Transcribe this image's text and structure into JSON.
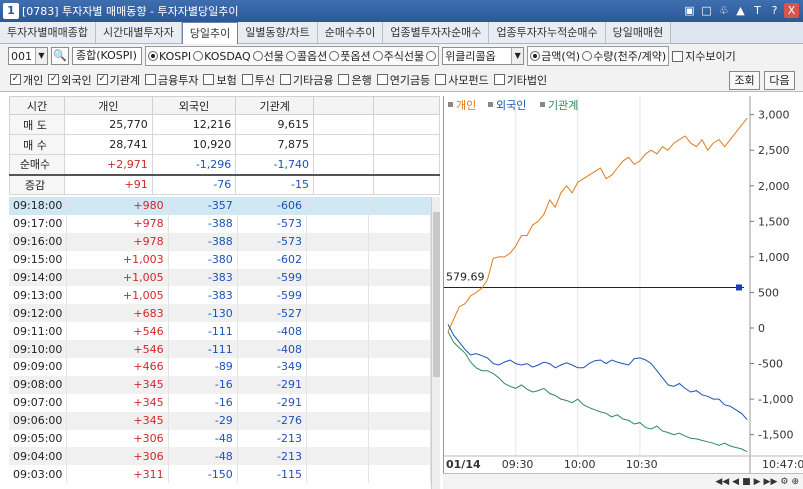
{
  "window": {
    "number": "1",
    "title": "[0783] 투자자별 매매동향 - 투자자별당일추이",
    "controls": [
      "▣",
      "□",
      "♧",
      "▲",
      "T",
      "?",
      "X"
    ]
  },
  "tabs": [
    {
      "label": "투자자별매매종합",
      "active": false
    },
    {
      "label": "시간대별투자자",
      "active": false
    },
    {
      "label": "당일추이",
      "active": true
    },
    {
      "label": "일별동향/차트",
      "active": false
    },
    {
      "label": "순매수추이",
      "active": false
    },
    {
      "label": "업종별투자자순매수",
      "active": false
    },
    {
      "label": "업종투자자누적순매수",
      "active": false
    },
    {
      "label": "당일매매현",
      "active": false
    }
  ],
  "controls": {
    "code_value": "001",
    "market_name": "종합(KOSPI)",
    "market_radios": [
      {
        "label": "KOSPI",
        "on": true
      },
      {
        "label": "KOSDAQ",
        "on": false
      },
      {
        "label": "선물",
        "on": false
      },
      {
        "label": "콜옵션",
        "on": false
      },
      {
        "label": "풋옵션",
        "on": false
      },
      {
        "label": "주식선물",
        "on": false
      }
    ],
    "extra_select_value": "위클리콜옵",
    "unit_radios": [
      {
        "label": "금액(억)",
        "on": true
      },
      {
        "label": "수량(천주/계약)",
        "on": false
      }
    ],
    "index_view_label": "지수보이기"
  },
  "investor_checks": [
    {
      "label": "개인",
      "checked": true
    },
    {
      "label": "외국인",
      "checked": true
    },
    {
      "label": "기관계",
      "checked": true
    },
    {
      "label": "금융투자",
      "checked": false
    },
    {
      "label": "보험",
      "checked": false
    },
    {
      "label": "투신",
      "checked": false
    },
    {
      "label": "기타금융",
      "checked": false
    },
    {
      "label": "은행",
      "checked": false
    },
    {
      "label": "연기금등",
      "checked": false
    },
    {
      "label": "사모펀드",
      "checked": false
    },
    {
      "label": "기타법인",
      "checked": false
    }
  ],
  "buttons": {
    "search": "조회",
    "next": "다음"
  },
  "summary": {
    "headers": [
      "시간",
      "개인",
      "외국인",
      "기관계"
    ],
    "rows": [
      {
        "label": "매 도",
        "values": [
          "25,770",
          "12,216",
          "9,615"
        ],
        "colors": [
          "",
          "",
          ""
        ]
      },
      {
        "label": "매 수",
        "values": [
          "28,741",
          "10,920",
          "7,875"
        ],
        "colors": [
          "",
          "",
          ""
        ]
      },
      {
        "label": "순매수",
        "values": [
          "+2,971",
          "-1,296",
          "-1,740"
        ],
        "colors": [
          "red",
          "blue",
          "blue"
        ]
      },
      {
        "label": "증감",
        "values": [
          "+91",
          "-76",
          "-15"
        ],
        "colors": [
          "red",
          "blue",
          "blue"
        ]
      }
    ]
  },
  "time_rows": [
    {
      "time": "09:18:00",
      "ind": "+980",
      "frn": "-357",
      "inst": "-606"
    },
    {
      "time": "09:17:00",
      "ind": "+978",
      "frn": "-388",
      "inst": "-573"
    },
    {
      "time": "09:16:00",
      "ind": "+978",
      "frn": "-388",
      "inst": "-573"
    },
    {
      "time": "09:15:00",
      "ind": "+1,003",
      "frn": "-380",
      "inst": "-602"
    },
    {
      "time": "09:14:00",
      "ind": "+1,005",
      "frn": "-383",
      "inst": "-599"
    },
    {
      "time": "09:13:00",
      "ind": "+1,005",
      "frn": "-383",
      "inst": "-599"
    },
    {
      "time": "09:12:00",
      "ind": "+683",
      "frn": "-130",
      "inst": "-527"
    },
    {
      "time": "09:11:00",
      "ind": "+546",
      "frn": "-111",
      "inst": "-408"
    },
    {
      "time": "09:10:00",
      "ind": "+546",
      "frn": "-111",
      "inst": "-408"
    },
    {
      "time": "09:09:00",
      "ind": "+466",
      "frn": "-89",
      "inst": "-349"
    },
    {
      "time": "09:08:00",
      "ind": "+345",
      "frn": "-16",
      "inst": "-291"
    },
    {
      "time": "09:07:00",
      "ind": "+345",
      "frn": "-16",
      "inst": "-291"
    },
    {
      "time": "09:06:00",
      "ind": "+345",
      "frn": "-29",
      "inst": "-276"
    },
    {
      "time": "09:05:00",
      "ind": "+306",
      "frn": "-48",
      "inst": "-213"
    },
    {
      "time": "09:04:00",
      "ind": "+306",
      "frn": "-48",
      "inst": "-213"
    },
    {
      "time": "09:03:00",
      "ind": "+311",
      "frn": "-150",
      "inst": "-115"
    }
  ],
  "chart_data": {
    "type": "line",
    "legend": [
      "개인",
      "외국인",
      "기관계"
    ],
    "legend_placement": "top-left",
    "colors": {
      "개인": "#e07b1a",
      "외국인": "#1d52b8",
      "기관계": "#2e8b57"
    },
    "date_label": "01/14",
    "x_ticks": [
      "09:30",
      "10:00",
      "10:30",
      "10:47:0"
    ],
    "y_ticks": [
      3000,
      2500,
      2000,
      1500,
      1000,
      500,
      0,
      -500,
      -1000,
      -1500
    ],
    "y_tick_labels": [
      "3,000",
      "2,500",
      "2,000",
      "1,500",
      "1,000",
      "500",
      "0",
      "-500",
      "-1,000",
      "-1,500"
    ],
    "ylim": [
      -1800,
      3150
    ],
    "xlim": [
      0,
      107
    ],
    "crosshair_label": "579.69",
    "crosshair_value": 570,
    "series": [
      {
        "name": "개인",
        "x": [
          0,
          2,
          4,
          6,
          8,
          10,
          12,
          14,
          16,
          18,
          20,
          22,
          24,
          26,
          28,
          30,
          32,
          34,
          36,
          38,
          40,
          42,
          44,
          46,
          48,
          50,
          52,
          54,
          56,
          58,
          60,
          62,
          64,
          66,
          68,
          70,
          72,
          74,
          76,
          78,
          80,
          82,
          84,
          86,
          88,
          90,
          92,
          94,
          96,
          98,
          100,
          102,
          104,
          106
        ],
        "values": [
          -50,
          120,
          300,
          340,
          450,
          500,
          560,
          680,
          980,
          1000,
          1000,
          1050,
          1150,
          1300,
          1300,
          1450,
          1500,
          1600,
          1800,
          1700,
          1900,
          2000,
          1900,
          2050,
          2100,
          2150,
          2200,
          2250,
          2100,
          2150,
          2250,
          2350,
          2400,
          2300,
          2350,
          2450,
          2500,
          2450,
          2550,
          2500,
          2600,
          2650,
          2700,
          2600,
          2550,
          2650,
          2500,
          2600,
          2650,
          2550,
          2650,
          2750,
          2850,
          2950
        ]
      },
      {
        "name": "외국인",
        "x": [
          0,
          2,
          4,
          6,
          8,
          10,
          12,
          14,
          16,
          18,
          20,
          22,
          24,
          26,
          28,
          30,
          32,
          34,
          36,
          38,
          40,
          42,
          44,
          46,
          48,
          50,
          52,
          54,
          56,
          58,
          60,
          62,
          64,
          66,
          68,
          70,
          72,
          74,
          76,
          78,
          80,
          82,
          84,
          86,
          88,
          90,
          92,
          94,
          96,
          98,
          100,
          102,
          104,
          106
        ],
        "values": [
          50,
          -100,
          -200,
          -300,
          -380,
          -360,
          -390,
          -420,
          -500,
          -520,
          -480,
          -450,
          -500,
          -520,
          -500,
          -550,
          -520,
          -480,
          -500,
          -560,
          -520,
          -490,
          -520,
          -560,
          -560,
          -500,
          -460,
          -450,
          -500,
          -450,
          -480,
          -500,
          -520,
          -430,
          -420,
          -450,
          -500,
          -600,
          -700,
          -800,
          -820,
          -780,
          -850,
          -900,
          -880,
          -940,
          -960,
          -1000,
          -1000,
          -1080,
          -1100,
          -1150,
          -1200,
          -1290
        ]
      },
      {
        "name": "기관계",
        "x": [
          0,
          2,
          4,
          6,
          8,
          10,
          12,
          14,
          16,
          18,
          20,
          22,
          24,
          26,
          28,
          30,
          32,
          34,
          36,
          38,
          40,
          42,
          44,
          46,
          48,
          50,
          52,
          54,
          56,
          58,
          60,
          62,
          64,
          66,
          68,
          70,
          72,
          74,
          76,
          78,
          80,
          82,
          84,
          86,
          88,
          90,
          92,
          94,
          96,
          98,
          100,
          102,
          104,
          106
        ],
        "values": [
          -50,
          -200,
          -280,
          -350,
          -480,
          -560,
          -600,
          -600,
          -640,
          -700,
          -780,
          -820,
          -850,
          -800,
          -860,
          -900,
          -880,
          -850,
          -920,
          -950,
          -1000,
          -1020,
          -1050,
          -1000,
          -1080,
          -1120,
          -1150,
          -1180,
          -1200,
          -1250,
          -1220,
          -1280,
          -1300,
          -1350,
          -1330,
          -1400,
          -1420,
          -1380,
          -1450,
          -1470,
          -1500,
          -1480,
          -1520,
          -1550,
          -1560,
          -1580,
          -1600,
          -1620,
          -1650,
          -1620,
          -1660,
          -1680,
          -1700,
          -1740
        ]
      }
    ]
  }
}
